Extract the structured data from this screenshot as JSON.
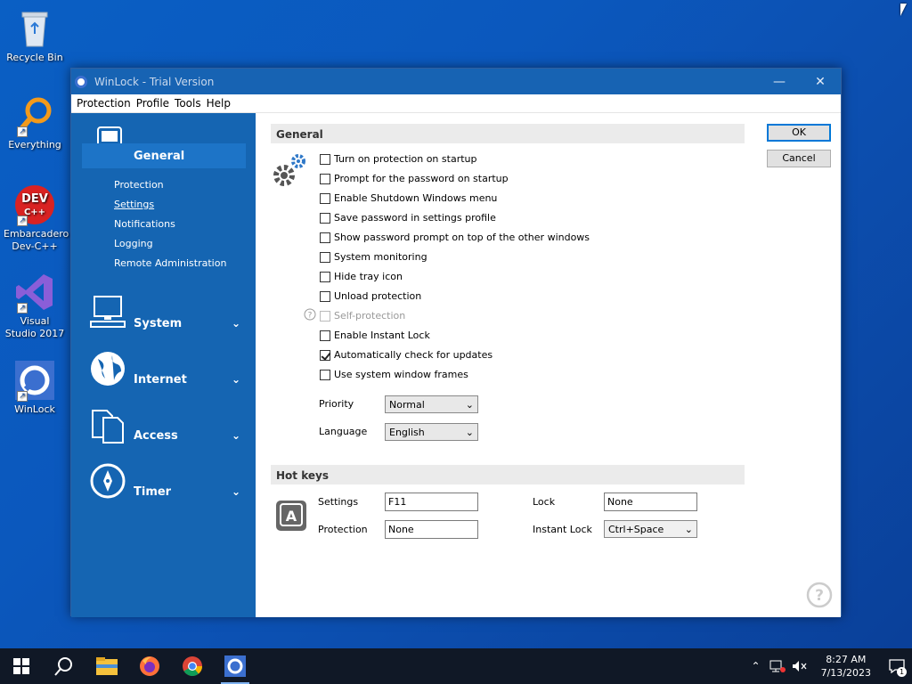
{
  "desktop": {
    "icons": [
      {
        "label": "Recycle Bin"
      },
      {
        "label": "Everything"
      },
      {
        "label": "Embarcadero Dev-C++"
      },
      {
        "label": "Visual Studio 2017"
      },
      {
        "label": "WinLock"
      }
    ]
  },
  "window": {
    "title": "WinLock - Trial Version",
    "menu": [
      "Protection",
      "Profile",
      "Tools",
      "Help"
    ],
    "minimize": "—",
    "close": "✕"
  },
  "sidebar": {
    "categories": [
      {
        "label": "General",
        "icon": "mobile-icon"
      },
      {
        "label": "System",
        "icon": "computer-icon"
      },
      {
        "label": "Internet",
        "icon": "globe-icon"
      },
      {
        "label": "Access",
        "icon": "files-icon"
      },
      {
        "label": "Timer",
        "icon": "compass-icon"
      }
    ],
    "subitems": [
      "Protection",
      "Settings",
      "Notifications",
      "Logging",
      "Remote Administration"
    ],
    "active_subitem": "Settings"
  },
  "general": {
    "header": "General",
    "options": [
      {
        "label": "Turn on protection on startup",
        "checked": false
      },
      {
        "label": "Prompt for the password on startup",
        "checked": false
      },
      {
        "label": "Enable Shutdown Windows menu",
        "checked": false
      },
      {
        "label": "Save password in settings profile",
        "checked": false
      },
      {
        "label": "Show password prompt on top of the other windows",
        "checked": false
      },
      {
        "label": "System monitoring",
        "checked": false
      },
      {
        "label": "Hide tray icon",
        "checked": false
      },
      {
        "label": "Unload protection",
        "checked": false
      },
      {
        "label": "Self-protection",
        "checked": false,
        "disabled": true
      },
      {
        "label": "Enable Instant Lock",
        "checked": false
      },
      {
        "label": "Automatically check for updates",
        "checked": true
      },
      {
        "label": "Use system window frames",
        "checked": false
      }
    ],
    "priority_label": "Priority",
    "priority_value": "Normal",
    "language_label": "Language",
    "language_value": "English"
  },
  "hotkeys": {
    "header": "Hot keys",
    "settings_label": "Settings",
    "settings_value": "F11",
    "protection_label": "Protection",
    "protection_value": "None",
    "lock_label": "Lock",
    "lock_value": "None",
    "instant_lock_label": "Instant Lock",
    "instant_lock_value": "Ctrl+Space"
  },
  "buttons": {
    "ok": "OK",
    "cancel": "Cancel"
  },
  "taskbar": {
    "time": "8:27 AM",
    "date": "7/13/2023",
    "notification_count": "1"
  }
}
